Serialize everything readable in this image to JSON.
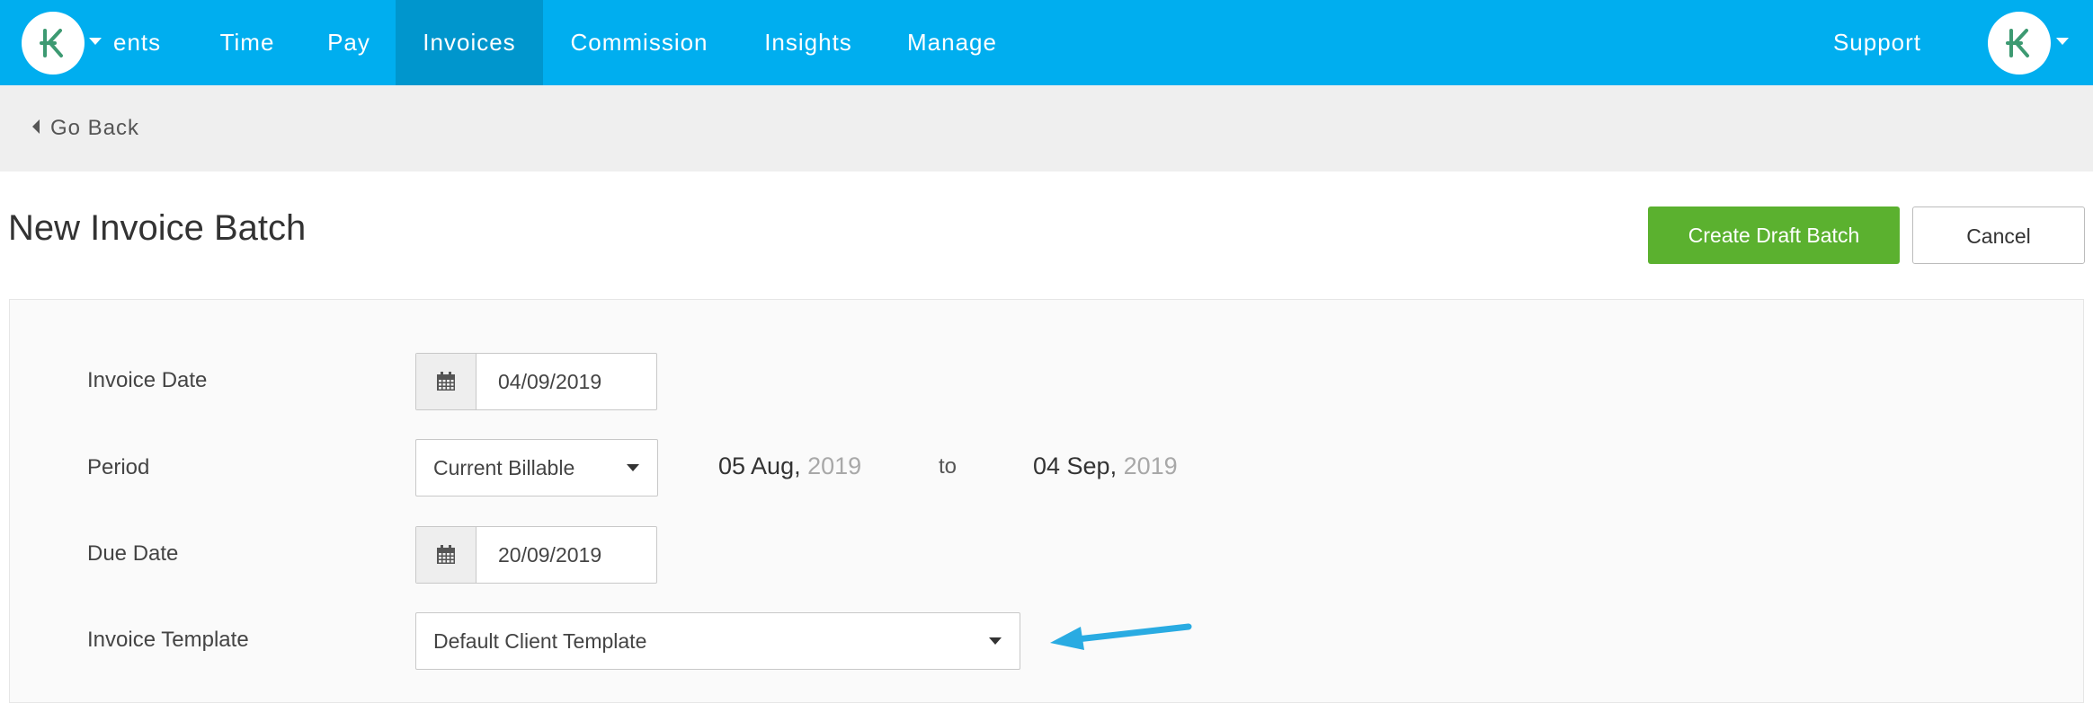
{
  "nav": {
    "items": [
      {
        "label": "ents",
        "active": false
      },
      {
        "label": "Time",
        "active": false
      },
      {
        "label": "Pay",
        "active": false
      },
      {
        "label": "Invoices",
        "active": true
      },
      {
        "label": "Commission",
        "active": false
      },
      {
        "label": "Insights",
        "active": false
      },
      {
        "label": "Manage",
        "active": false
      }
    ],
    "support": "Support"
  },
  "back": {
    "label": "Go Back"
  },
  "page": {
    "title": "New Invoice Batch",
    "create_label": "Create Draft Batch",
    "cancel_label": "Cancel"
  },
  "form": {
    "invoice_date": {
      "label": "Invoice Date",
      "value": "04/09/2019"
    },
    "period": {
      "label": "Period",
      "value": "Current Billable",
      "from_day": "05 Aug,",
      "from_year": "2019",
      "to_word": "to",
      "to_day": "04 Sep,",
      "to_year": "2019"
    },
    "due_date": {
      "label": "Due Date",
      "value": "20/09/2019"
    },
    "template": {
      "label": "Invoice Template",
      "value": "Default Client Template"
    }
  },
  "colors": {
    "nav_bg": "#00aeef",
    "nav_active": "#0096cd",
    "primary": "#5bb12f",
    "logo_green": "#3d9a72",
    "annotation_arrow": "#29abe2"
  },
  "icons": {
    "logo": "brand-logo-icon",
    "calendar": "calendar-icon",
    "back": "caret-left-icon",
    "dropdown": "chevron-down-icon",
    "annotation": "arrow-left-icon"
  }
}
